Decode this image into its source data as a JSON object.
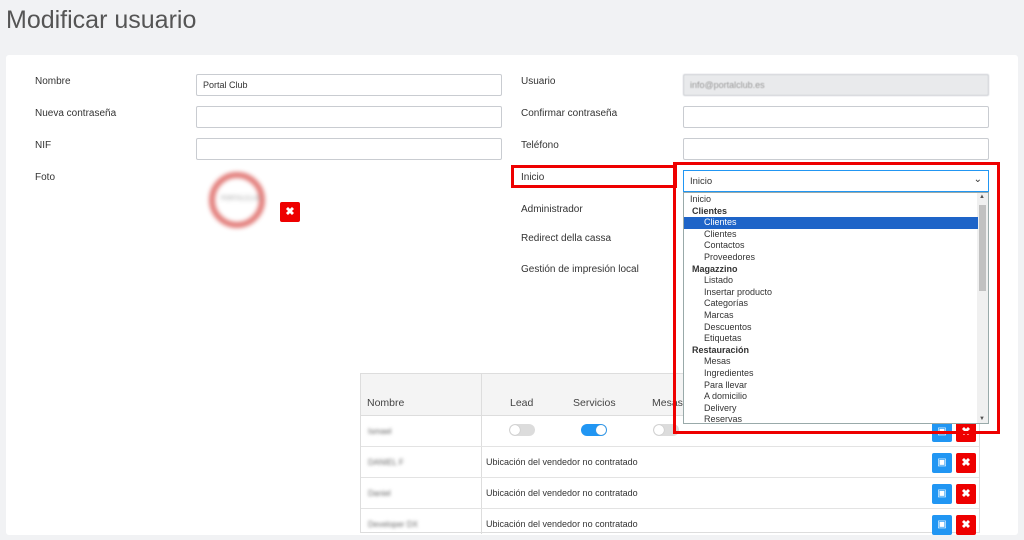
{
  "page": {
    "title": "Modificar usuario"
  },
  "form": {
    "nombre_label": "Nombre",
    "nombre_value": "Portal Club",
    "nueva_contrasena_label": "Nueva contraseña",
    "nif_label": "NIF",
    "foto_label": "Foto",
    "photo_text": "PORTALCLUB",
    "usuario_label": "Usuario",
    "usuario_value": "info@portalclub.es",
    "confirmar_label": "Confirmar contraseña",
    "telefono_label": "Teléfono",
    "inicio_label": "Inicio",
    "inicio_value": "Inicio",
    "administrador_label": "Administrador",
    "redirect_label": "Redirect della cassa",
    "gestion_label": "Gestión de impresión local"
  },
  "dropdown": {
    "options": [
      {
        "label": "Inicio",
        "kind": "top"
      },
      {
        "label": "Clientes",
        "kind": "group"
      },
      {
        "label": "Clientes",
        "kind": "item",
        "selected": true
      },
      {
        "label": "Clientes",
        "kind": "item"
      },
      {
        "label": "Contactos",
        "kind": "item"
      },
      {
        "label": "Proveedores",
        "kind": "item"
      },
      {
        "label": "Magazzino",
        "kind": "group"
      },
      {
        "label": "Listado",
        "kind": "item"
      },
      {
        "label": "Insertar producto",
        "kind": "item"
      },
      {
        "label": "Categorías",
        "kind": "item"
      },
      {
        "label": "Marcas",
        "kind": "item"
      },
      {
        "label": "Descuentos",
        "kind": "item"
      },
      {
        "label": "Etiquetas",
        "kind": "item"
      },
      {
        "label": "Restauración",
        "kind": "group"
      },
      {
        "label": "Mesas",
        "kind": "item"
      },
      {
        "label": "Ingredientes",
        "kind": "item"
      },
      {
        "label": "Para llevar",
        "kind": "item"
      },
      {
        "label": "A domicilio",
        "kind": "item"
      },
      {
        "label": "Delivery",
        "kind": "item"
      },
      {
        "label": "Reservas",
        "kind": "item"
      }
    ]
  },
  "table": {
    "col_nombre": "Nombre",
    "col_lead": "Lead",
    "col_servicios": "Servicios",
    "col_mesas": "Mesas",
    "rows": [
      {
        "name": "Ismael",
        "message": ""
      },
      {
        "name": "DANIEL F",
        "message": "Ubicación del vendedor no contratado"
      },
      {
        "name": "Daniel",
        "message": "Ubicación del vendedor no contratado"
      },
      {
        "name": "Developer DX",
        "message": "Ubicación del vendedor no contratado"
      }
    ]
  },
  "colors": {
    "accent": "#2196f3",
    "danger": "#e00000",
    "highlight_box": "#e00000",
    "selected_option": "#1e64c8"
  }
}
